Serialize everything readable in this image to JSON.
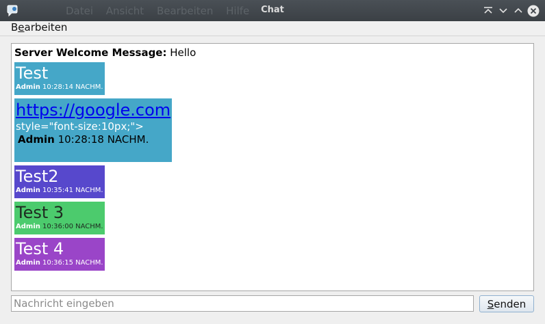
{
  "window": {
    "title": "Chat",
    "ghost_menu": "Datei Ansicht Bearbeiten Hilfe"
  },
  "menubar": {
    "items": [
      {
        "mnemonic_pre": "B",
        "mnemonic": "e",
        "rest": "arbeiten"
      }
    ]
  },
  "chat": {
    "welcome_label": "Server Welcome Message:",
    "welcome_text": " Hello",
    "messages": [
      {
        "text": "Test",
        "user": "Admin",
        "time": " 10:28:14 NACHM.",
        "color": "#45a7c8"
      },
      {
        "link": "https://google.com",
        "raw": "style=\"font-size:10px;\">",
        "user": "Admin",
        "time": " 10:28:18 NACHM.",
        "color": "#45a7c8"
      },
      {
        "text": "Test2",
        "user": "Admin",
        "time": " 10:35:41 NACHM.",
        "color": "#5748cc"
      },
      {
        "text": "Test 3",
        "user": "Admin",
        "time": " 10:36:00 NACHM.",
        "color": "#4ccb6d"
      },
      {
        "text": "Test 4",
        "user": "Admin",
        "time": " 10:36:15 NACHM.",
        "color": "#9a45c8"
      }
    ]
  },
  "input": {
    "placeholder": "Nachricht eingeben",
    "value": ""
  },
  "send_button": {
    "mnemonic": "S",
    "rest": "enden"
  }
}
